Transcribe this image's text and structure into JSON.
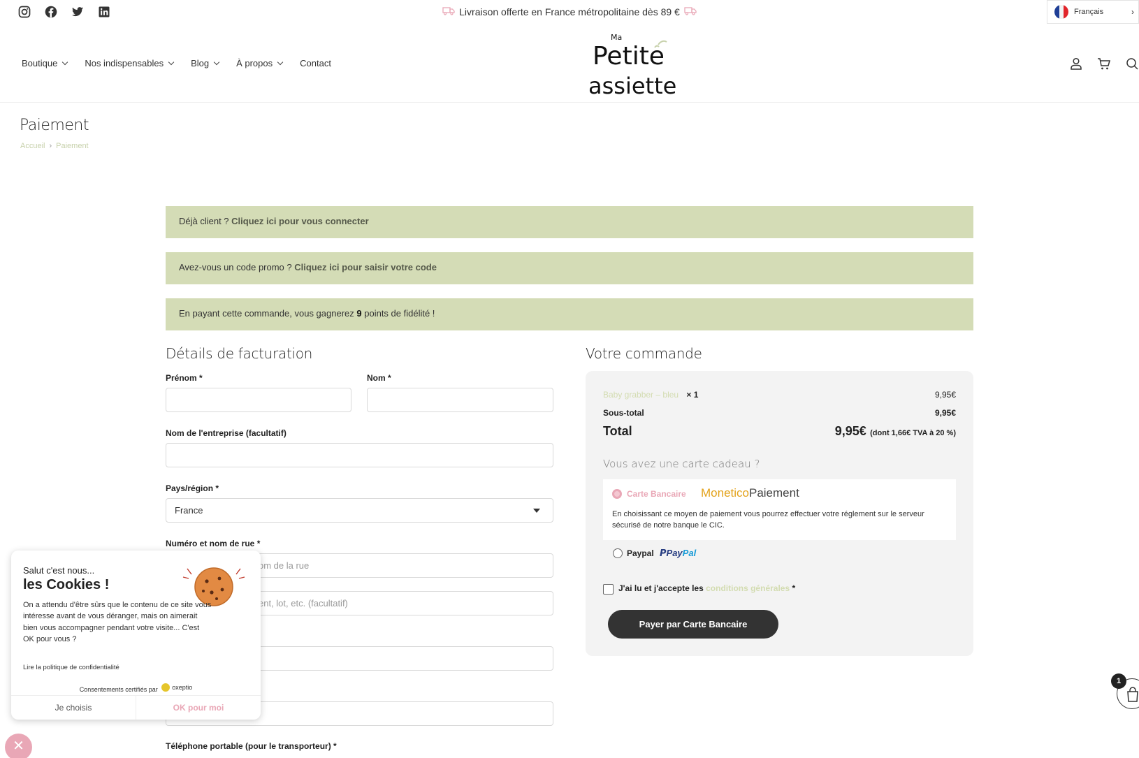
{
  "topbar": {
    "social_icons": [
      "instagram-icon",
      "facebook-icon",
      "twitter-icon",
      "linkedin-icon"
    ],
    "promo": "Livraison offerte en France métropolitaine dès 89 €",
    "language": "Français"
  },
  "nav": {
    "items": [
      {
        "label": "Boutique",
        "has_dropdown": true
      },
      {
        "label": "Nos indispensables",
        "has_dropdown": true
      },
      {
        "label": "Blog",
        "has_dropdown": true
      },
      {
        "label": "À propos",
        "has_dropdown": true
      },
      {
        "label": "Contact",
        "has_dropdown": false
      }
    ]
  },
  "logo": {
    "line0": "Ma",
    "line1": "Petite",
    "line2": "assiette"
  },
  "page": {
    "title": "Paiement",
    "breadcrumb": [
      "Accueil",
      "Paiement"
    ]
  },
  "notices": {
    "login": {
      "text": "Déjà client ? ",
      "link": "Cliquez ici pour vous connecter"
    },
    "promo": {
      "text": "Avez-vous un code promo ? ",
      "link": "Cliquez ici pour saisir votre code"
    },
    "points": {
      "before": "En payant cette commande, vous gagnerez ",
      "points": "9",
      "after": " points de fidélité !"
    }
  },
  "billing": {
    "title": "Détails de facturation",
    "first_name_label": "Prénom *",
    "last_name_label": "Nom *",
    "company_label": "Nom de l'entreprise (facultatif)",
    "country_label": "Pays/région *",
    "country_value": "France",
    "street_label": "Numéro et nom de rue *",
    "street_placeholder": "om de la rue",
    "street2_placeholder": "ent, lot, etc. (facultatif)",
    "phone_label": "Téléphone portable (pour le transporteur) *"
  },
  "order": {
    "title": "Votre commande",
    "product_name": "Baby grabber – bleu",
    "product_qty": "× 1",
    "product_price": "9,95€",
    "subtotal_label": "Sous-total",
    "subtotal_value": "9,95€",
    "total_label": "Total",
    "total_value": "9,95€",
    "total_tax": "(dont 1,66€ TVA à 20 %)",
    "gift_question": "Vous avez une carte cadeau ?",
    "payment_card_label": "Carte Bancaire",
    "monetico_a": "Monetico",
    "monetico_b": "Paiement",
    "payment_card_desc": "En choisissant ce moyen de paiement vous pourrez effectuer votre réglement sur le serveur sécurisé de notre banque le CIC.",
    "payment_paypal_label": "Paypal",
    "paypal_logo_a": "Pay",
    "paypal_logo_b": "Pal",
    "terms_before": "J'ai lu et j'accepte les ",
    "terms_link": "conditions générales",
    "terms_after": " *",
    "pay_button": "Payer par Carte Bancaire"
  },
  "cookie": {
    "greeting": "Salut c'est nous...",
    "headline": "les Cookies !",
    "body": "On a attendu d'être sûrs que le contenu de ce site vous intéresse avant de vous déranger, mais on aimerait bien vous accompagner pendant votre visite... C'est OK pour vous ?",
    "policy_link": "Lire la politique de confidentialité",
    "certified": "Consentements certifiés par",
    "certifier": "oxeptio",
    "choose_button": "Je choisis",
    "ok_button": "OK pour moi",
    "close_glyph": "✕"
  },
  "cart": {
    "badge": "1"
  },
  "colors": {
    "notice_bg": "#d4dcb6",
    "accent_pink": "#e9a7b6",
    "link_green": "#c7d1ab",
    "button_dark": "#333333"
  }
}
